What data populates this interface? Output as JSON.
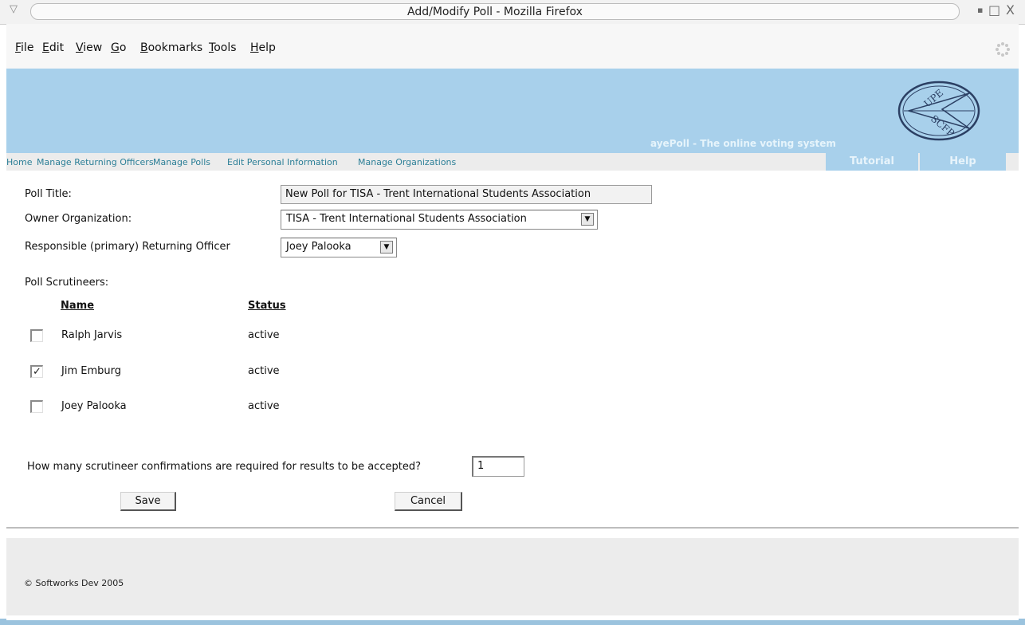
{
  "window": {
    "title": "Add/Modify Poll - Mozilla Firefox",
    "controls": {
      "minimize": "▪",
      "maximize": "□",
      "close": "X"
    }
  },
  "menubar": {
    "items": [
      {
        "mnemonic": "F",
        "rest": "ile"
      },
      {
        "mnemonic": "E",
        "rest": "dit"
      },
      {
        "mnemonic": "V",
        "rest": "iew"
      },
      {
        "mnemonic": "G",
        "rest": "o"
      },
      {
        "mnemonic": "B",
        "rest": "ookmarks"
      },
      {
        "mnemonic": "T",
        "rest": "ools"
      },
      {
        "mnemonic": "H",
        "rest": "elp"
      }
    ]
  },
  "banner": {
    "tagline": "ayePoll - The online voting system",
    "logo_text": "UPE SCFP"
  },
  "nav": {
    "links": [
      "Home",
      "Manage Returning Officers",
      "Manage Polls",
      "Edit Personal Information",
      "Manage Organizations"
    ],
    "tabs": [
      "Tutorial",
      "Help"
    ]
  },
  "form": {
    "poll_title_label": "Poll Title:",
    "poll_title_value": "New Poll for TISA - Trent International Students Association",
    "owner_label": "Owner Organization:",
    "owner_value": "TISA - Trent International Students Association",
    "officer_label": "Responsible (primary) Returning Officer",
    "officer_value": "Joey Palooka",
    "scrutineers_label": "Poll Scrutineers:",
    "col_name": "Name",
    "col_status": "Status",
    "scrutineers": [
      {
        "name": "Ralph Jarvis",
        "status": "active",
        "checked": false
      },
      {
        "name": "Jim Emburg",
        "status": "active",
        "checked": true
      },
      {
        "name": "Joey Palooka",
        "status": "active",
        "checked": false
      }
    ],
    "confirm_label": "How many scrutineer confirmations are required for results to be accepted?",
    "confirm_value": "1",
    "save_label": "Save",
    "cancel_label": "Cancel"
  },
  "footer": {
    "copyright": "© Softworks Dev 2005"
  },
  "colors": {
    "banner": "#a8d0eb",
    "link": "#2c7f97",
    "footer": "#ececec"
  }
}
